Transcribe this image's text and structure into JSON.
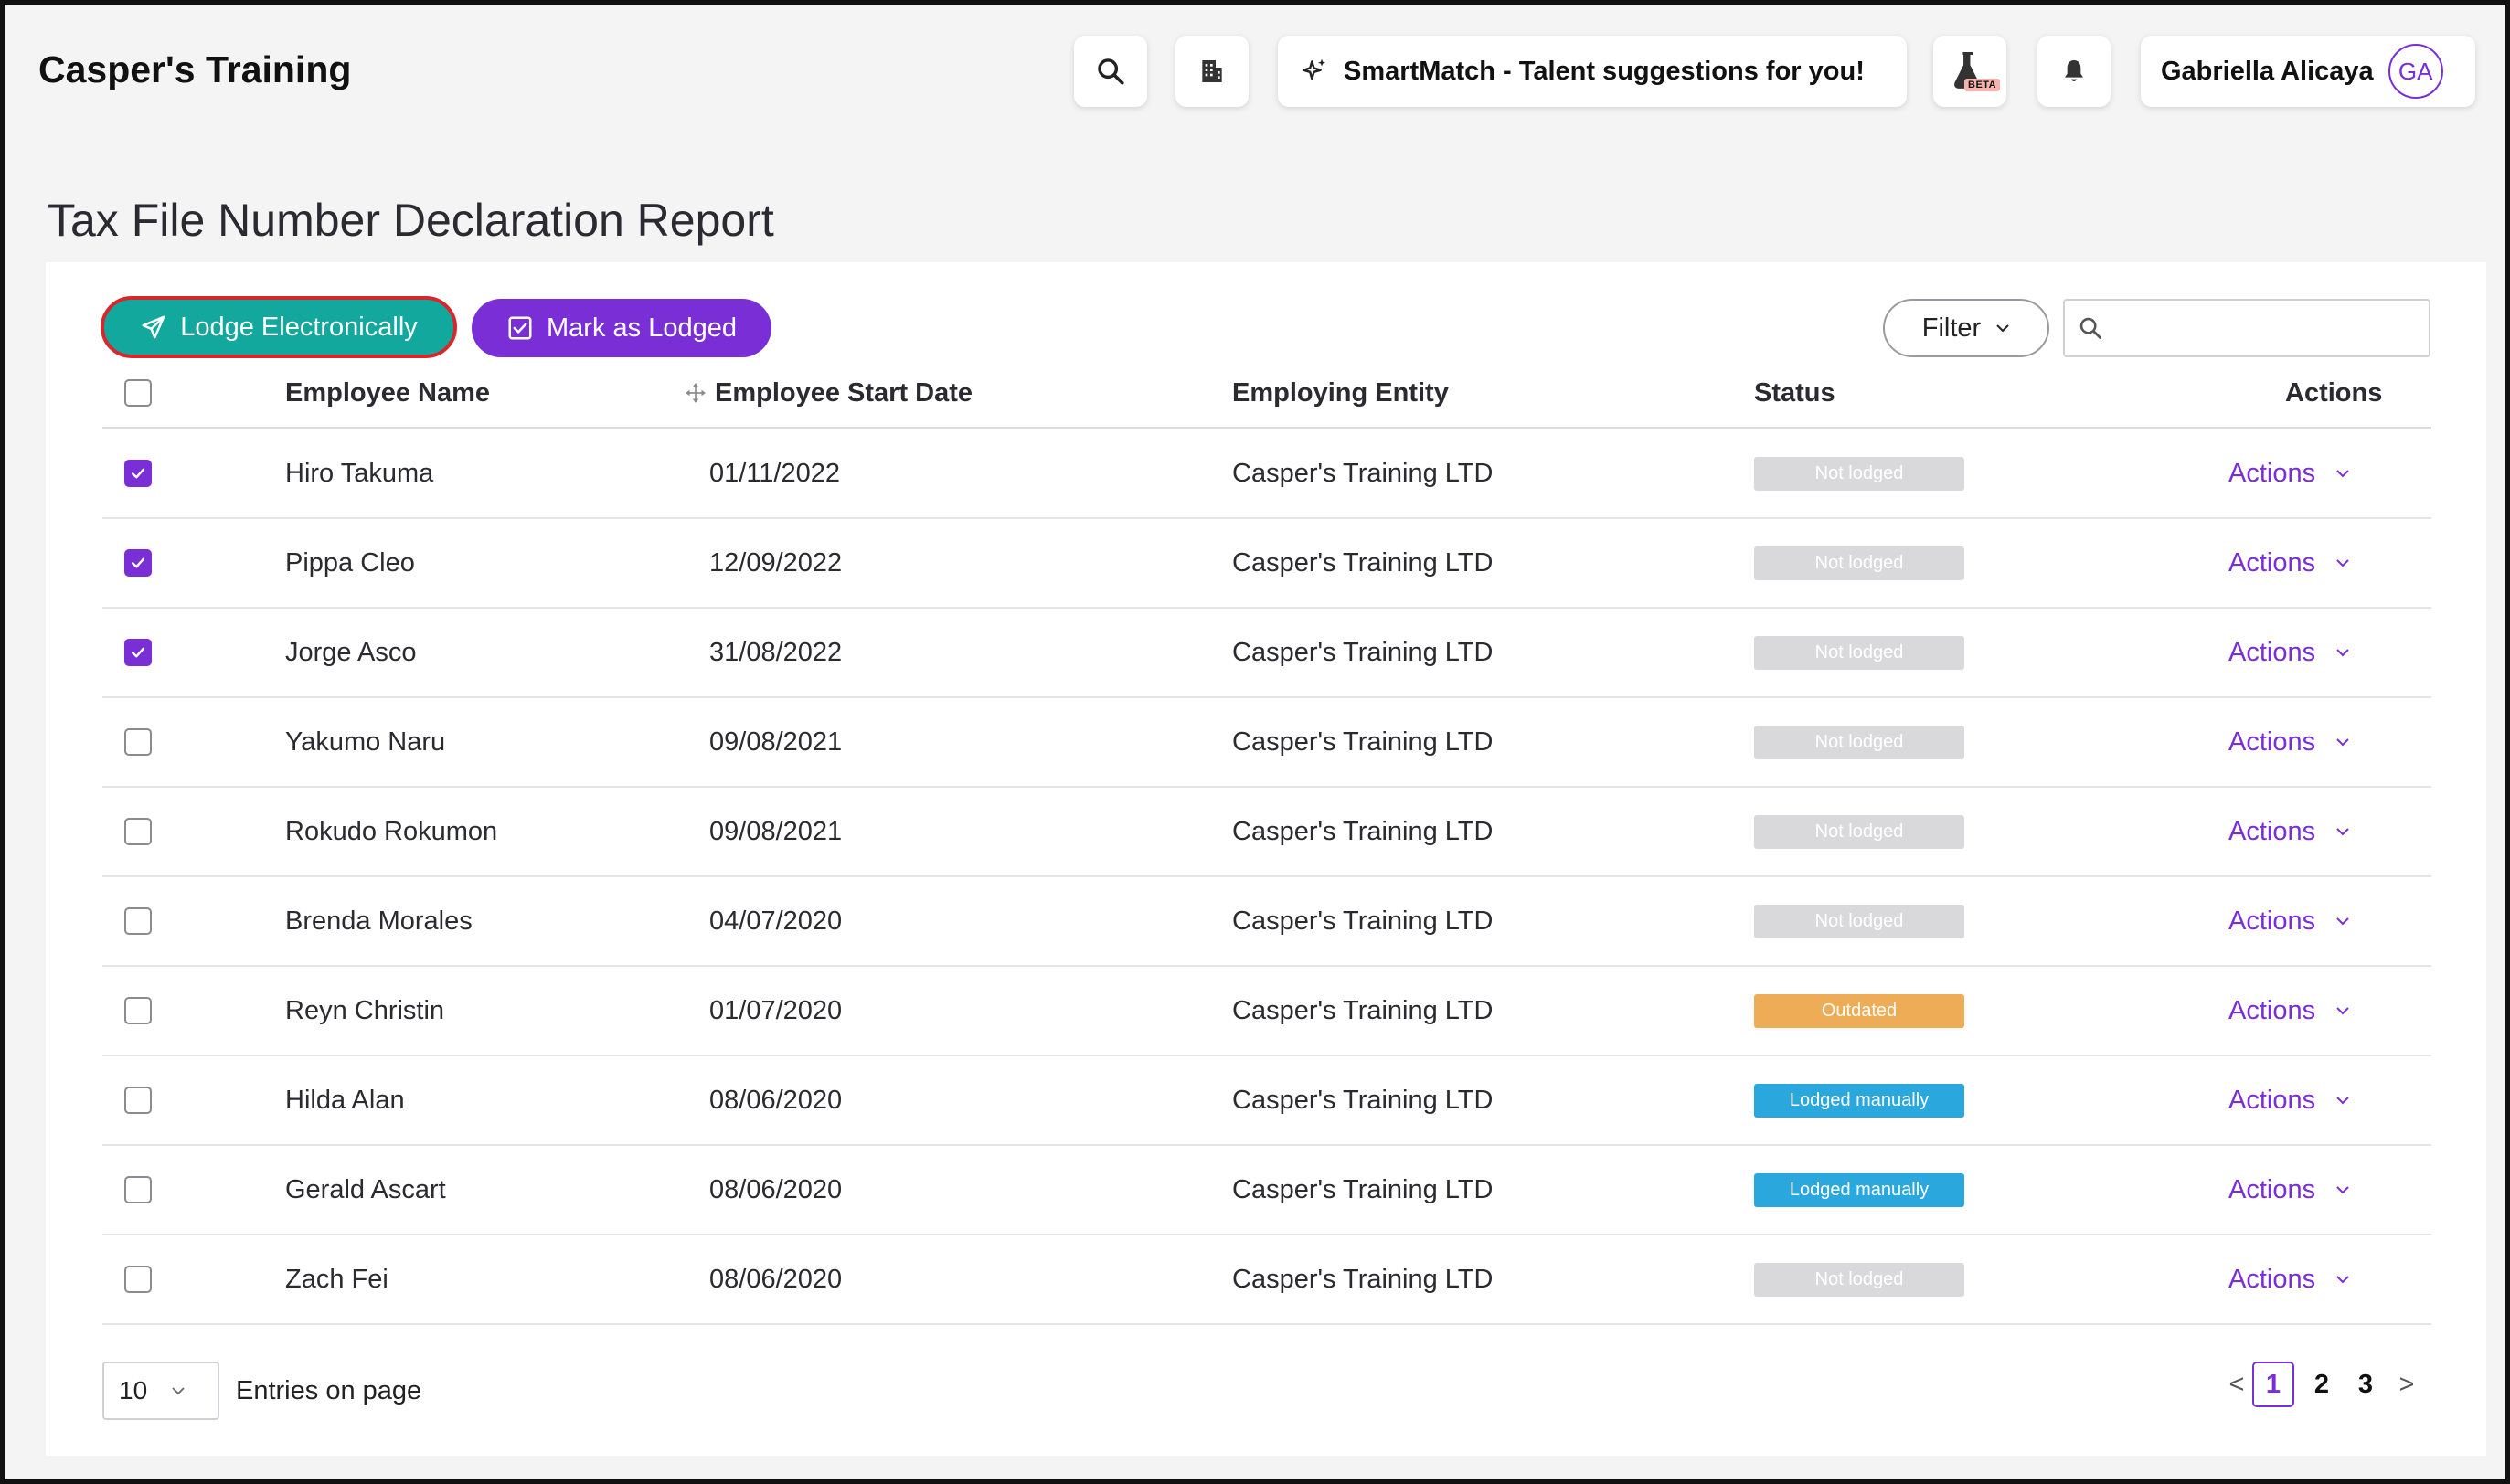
{
  "header": {
    "brand": "Casper's Training",
    "smartmatch_label": "SmartMatch - Talent suggestions for you!",
    "beta_label": "BETA",
    "user_name": "Gabriella Alicaya",
    "user_initials": "GA"
  },
  "page": {
    "title": "Tax File Number Declaration Report"
  },
  "toolbar": {
    "lodge_label": "Lodge Electronically",
    "mark_label": "Mark as Lodged",
    "filter_label": "Filter",
    "search_placeholder": ""
  },
  "table": {
    "columns": {
      "name": "Employee Name",
      "start_date": "Employee Start Date",
      "entity": "Employing Entity",
      "status": "Status",
      "actions": "Actions"
    },
    "rows": [
      {
        "name": "Hiro Takuma",
        "start_date": "01/11/2022",
        "entity": "Casper's Training LTD",
        "status": "Not lodged",
        "status_color": "#d9d9dc",
        "action": "Actions",
        "checked": true
      },
      {
        "name": "Pippa Cleo",
        "start_date": "12/09/2022",
        "entity": "Casper's Training LTD",
        "status": "Not lodged",
        "status_color": "#d9d9dc",
        "action": "Actions",
        "checked": true
      },
      {
        "name": "Jorge Asco",
        "start_date": "31/08/2022",
        "entity": "Casper's Training LTD",
        "status": "Not lodged",
        "status_color": "#d9d9dc",
        "action": "Actions",
        "checked": true
      },
      {
        "name": "Yakumo Naru",
        "start_date": "09/08/2021",
        "entity": "Casper's Training LTD",
        "status": "Not lodged",
        "status_color": "#d9d9dc",
        "action": "Actions",
        "checked": false
      },
      {
        "name": "Rokudo Rokumon",
        "start_date": "09/08/2021",
        "entity": "Casper's Training LTD",
        "status": "Not lodged",
        "status_color": "#d9d9dc",
        "action": "Actions",
        "checked": false
      },
      {
        "name": "Brenda Morales",
        "start_date": "04/07/2020",
        "entity": "Casper's Training LTD",
        "status": "Not lodged",
        "status_color": "#d9d9dc",
        "action": "Actions",
        "checked": false
      },
      {
        "name": "Reyn Christin",
        "start_date": "01/07/2020",
        "entity": "Casper's Training LTD",
        "status": "Outdated",
        "status_color": "#efac57",
        "action": "Actions",
        "checked": false
      },
      {
        "name": "Hilda Alan",
        "start_date": "08/06/2020",
        "entity": "Casper's Training LTD",
        "status": "Lodged manually",
        "status_color": "#2aa7dc",
        "action": "Actions",
        "checked": false
      },
      {
        "name": "Gerald Ascart",
        "start_date": "08/06/2020",
        "entity": "Casper's Training LTD",
        "status": "Lodged manually",
        "status_color": "#2aa7dc",
        "action": "Actions",
        "checked": false
      },
      {
        "name": "Zach Fei",
        "start_date": "08/06/2020",
        "entity": "Casper's Training LTD",
        "status": "Not lodged",
        "status_color": "#d9d9dc",
        "action": "Actions",
        "checked": false
      }
    ]
  },
  "footer": {
    "per_page_value": "10",
    "entries_label": "Entries on page",
    "pages": [
      "1",
      "2",
      "3"
    ],
    "current_page": "1",
    "prev_label": "<",
    "next_label": ">"
  },
  "colors": {
    "accent": "#7a2ed6",
    "lodge_button": "#13a89e",
    "lodge_button_outline": "#d7262c",
    "status_not_lodged": "#d9d9dc",
    "status_outdated": "#efac57",
    "status_lodged_manually": "#2aa7dc"
  },
  "icons": {
    "search": "search-icon",
    "building": "building-icon",
    "sparkle": "sparkle-icon",
    "flask": "flask-icon",
    "bell": "bell-icon",
    "send": "send-icon",
    "checkbox": "checkbox-icon",
    "chevron": "chevron-down-icon",
    "sort": "sort-icon"
  }
}
